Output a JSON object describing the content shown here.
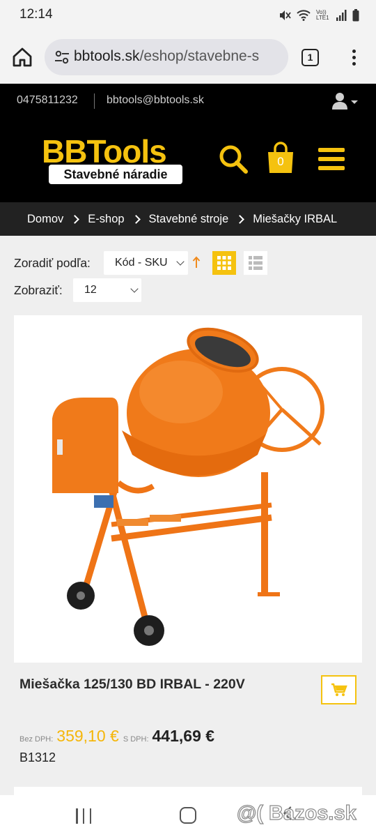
{
  "status_bar": {
    "time": "12:14",
    "icons": [
      "mute-icon",
      "wifi-icon",
      "volte-icon",
      "signal-icon",
      "battery-icon"
    ],
    "volte_label": "Vo)) LTE1"
  },
  "browser": {
    "url_host": "bbtools.sk",
    "url_path": "/eshop/stavebne-s",
    "tab_count": "1"
  },
  "topbar": {
    "phone": "0475811232",
    "email": "bbtools@bbtools.sk"
  },
  "header": {
    "brand": "BBTools",
    "tagline": "Stavebné náradie",
    "cart_count": "0"
  },
  "breadcrumbs": [
    "Domov",
    "E-shop",
    "Stavebné stroje",
    "Miešačky IRBAL"
  ],
  "toolbar": {
    "sort_label": "Zoradiť podľa:",
    "sort_value": "Kód - SKU",
    "show_label": "Zobraziť:",
    "show_value": "12"
  },
  "product": {
    "title": "Miešačka 125/130 BD IRBAL - 220V",
    "net_label": "Bez DPH:",
    "net_price": "359,10 €",
    "gross_label": "S DPH:",
    "gross_price": "441,69 €",
    "sku": "B1312"
  },
  "watermark": "@( Bazos.sk",
  "colors": {
    "accent": "#f5c20f",
    "header_bg": "#000000",
    "breadcrumb_bg": "#222222",
    "mixer_orange": "#f07a1a"
  }
}
